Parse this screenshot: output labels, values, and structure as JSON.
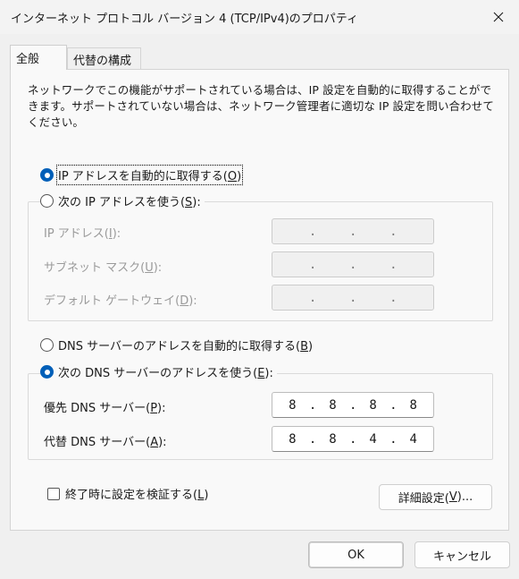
{
  "window": {
    "title": "インターネット プロトコル バージョン 4 (TCP/IPv4)のプロパティ",
    "close_glyph": "✕"
  },
  "tabs": [
    {
      "label": "全般",
      "active": true
    },
    {
      "label": "代替の構成",
      "active": false
    }
  ],
  "description": "ネットワークでこの機能がサポートされている場合は、IP 設定を自動的に取得することができます。サポートされていない場合は、ネットワーク管理者に適切な IP 設定を問い合わせてください。",
  "ip_section": {
    "auto_label_pre": "IP アドレスを自動的に取得する(",
    "auto_key": "O",
    "auto_label_post": ")",
    "auto_selected": true,
    "manual_label_pre": "次の IP アドレスを使う(",
    "manual_key": "S",
    "manual_label_post": "):",
    "fields": [
      {
        "pre": "IP アドレス(",
        "key": "I",
        "post": "):",
        "octets": [
          "",
          "",
          "",
          ""
        ],
        "enabled": false
      },
      {
        "pre": "サブネット マスク(",
        "key": "U",
        "post": "):",
        "octets": [
          "",
          "",
          "",
          ""
        ],
        "enabled": false
      },
      {
        "pre": "デフォルト ゲートウェイ(",
        "key": "D",
        "post": "):",
        "octets": [
          "",
          "",
          "",
          ""
        ],
        "enabled": false
      }
    ]
  },
  "dns_section": {
    "auto_label_pre": "DNS サーバーのアドレスを自動的に取得する(",
    "auto_key": "B",
    "auto_label_post": ")",
    "manual_label_pre": "次の DNS サーバーのアドレスを使う(",
    "manual_key": "E",
    "manual_label_post": "):",
    "manual_selected": true,
    "fields": [
      {
        "pre": "優先 DNS サーバー(",
        "key": "P",
        "post": "):",
        "octets": [
          "8",
          "8",
          "8",
          "8"
        ],
        "enabled": true
      },
      {
        "pre": "代替 DNS サーバー(",
        "key": "A",
        "post": "):",
        "octets": [
          "8",
          "8",
          "4",
          "4"
        ],
        "enabled": true
      }
    ]
  },
  "validate": {
    "label_pre": "終了時に設定を検証する(",
    "key": "L",
    "label_post": ")",
    "checked": false
  },
  "advanced_button": {
    "pre": "詳細設定(",
    "key": "V",
    "post": ")..."
  },
  "footer": {
    "ok": "OK",
    "cancel": "キャンセル"
  },
  "colors": {
    "accent": "#005fb8",
    "background": "#f0f0f0",
    "panel": "#f9f9f9"
  }
}
